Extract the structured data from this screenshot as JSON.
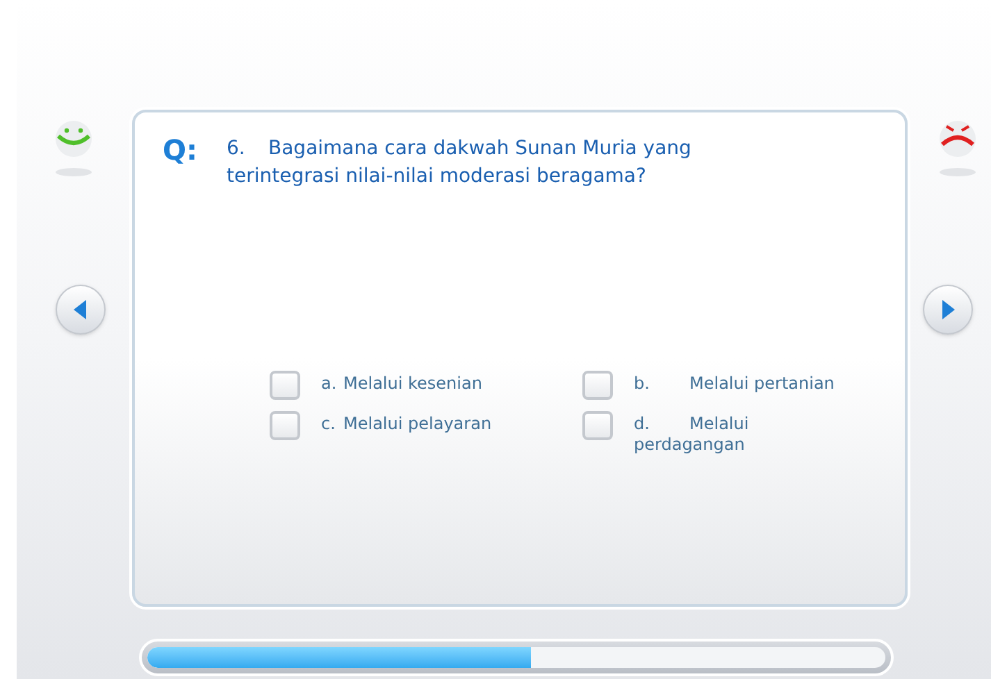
{
  "question": {
    "prefix": "Q:",
    "number": "6.",
    "text": "Bagaimana cara dakwah Sunan Muria yang terintegrasi nilai-nilai moderasi beragama?"
  },
  "options": [
    {
      "letter": "a.",
      "text": "Melalui kesenian",
      "checked": false
    },
    {
      "letter": "b.",
      "text": "Melalui pertanian",
      "checked": false
    },
    {
      "letter": "c.",
      "text": "Melalui pelayaran",
      "checked": false
    },
    {
      "letter": "d.",
      "text": "Melalui perdagangan",
      "checked": false
    }
  ],
  "progress": {
    "level": 0.52
  }
}
